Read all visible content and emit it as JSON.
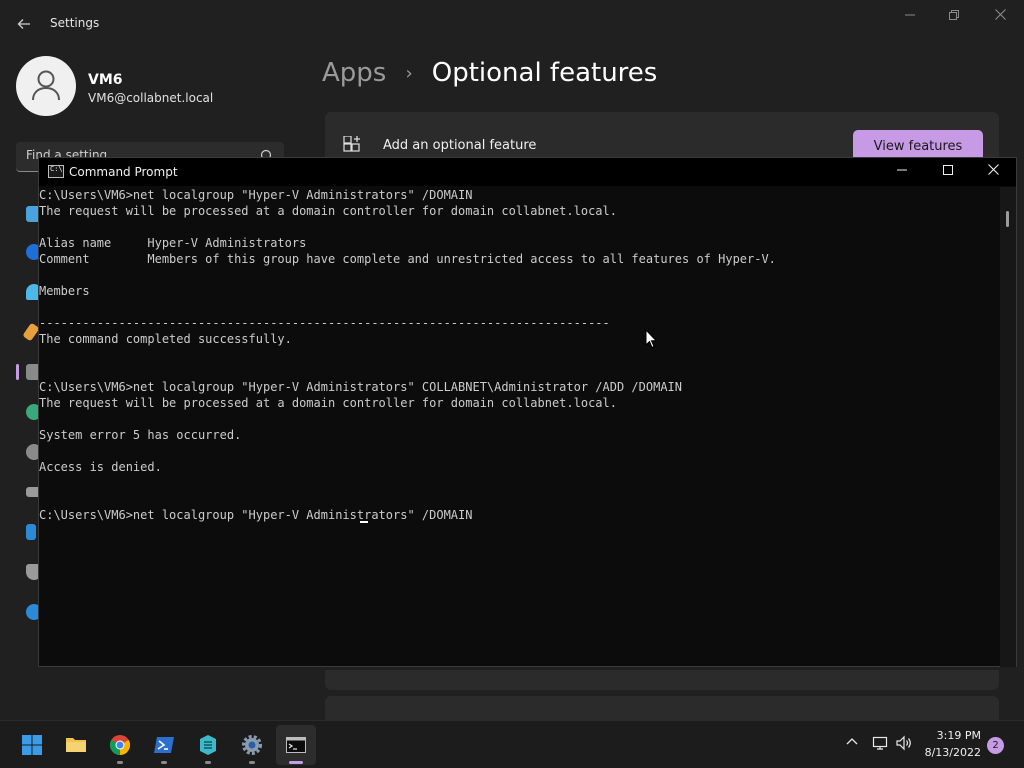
{
  "settings": {
    "window_title": "Settings",
    "profile": {
      "name": "VM6",
      "email": "VM6@collabnet.local"
    },
    "search_placeholder": "Find a setting",
    "breadcrumb": {
      "parent": "Apps",
      "separator": "›",
      "current": "Optional features"
    },
    "add_feature_label": "Add an optional feature",
    "view_features_label": "View features",
    "accent_color": "#c79ae6"
  },
  "cmd": {
    "title": "Command Prompt",
    "icon_text": "C:\\",
    "lines": [
      "C:\\Users\\VM6>net localgroup \"Hyper-V Administrators\" /DOMAIN",
      "The request will be processed at a domain controller for domain collabnet.local.",
      "",
      "Alias name     Hyper-V Administrators",
      "Comment        Members of this group have complete and unrestricted access to all features of Hyper-V.",
      "",
      "Members",
      "",
      "-------------------------------------------------------------------------------",
      "The command completed successfully.",
      "",
      "",
      "C:\\Users\\VM6>net localgroup \"Hyper-V Administrators\" COLLABNET\\Administrator /ADD /DOMAIN",
      "The request will be processed at a domain controller for domain collabnet.local.",
      "",
      "System error 5 has occurred.",
      "",
      "Access is denied.",
      "",
      "",
      "C:\\Users\\VM6>net localgroup \"Hyper-V Administrators\" /DOMAIN"
    ]
  },
  "taskbar": {
    "apps": [
      "start-button",
      "file-explorer",
      "chrome",
      "powershell",
      "azure-data-studio",
      "settings",
      "command-prompt"
    ],
    "tray_icons": [
      "chevron-up-icon",
      "network-icon",
      "volume-icon"
    ],
    "time": "3:19 PM",
    "date": "8/13/2022",
    "notification_count": "2"
  }
}
